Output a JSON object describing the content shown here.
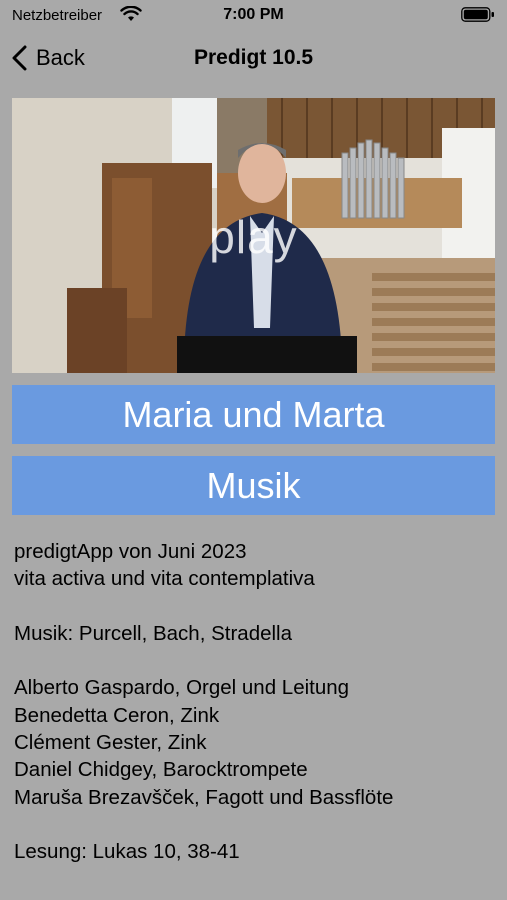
{
  "status": {
    "carrier": "Netzbetreiber",
    "time": "7:00 PM"
  },
  "nav": {
    "back_label": "Back",
    "title": "Predigt 10.5"
  },
  "video": {
    "play_label": "play"
  },
  "buttons": {
    "primary": "Maria und Marta",
    "secondary": "Musik"
  },
  "description": {
    "lines": [
      "predigtApp von Juni 2023",
      "vita activa und vita contemplativa",
      "",
      "Musik: Purcell, Bach, Stradella",
      "",
      "Alberto Gaspardo, Orgel und Leitung",
      "Benedetta Ceron, Zink",
      "Clément Gester, Zink",
      "Daniel Chidgey, Barocktrompete",
      "Maruša Brezavšček, Fagott und Bassflöte",
      "",
      "Lesung: Lukas 10, 38-41"
    ]
  },
  "colors": {
    "background": "#a9a9a9",
    "button": "#6a9ae0",
    "button_text": "#ffffff"
  }
}
